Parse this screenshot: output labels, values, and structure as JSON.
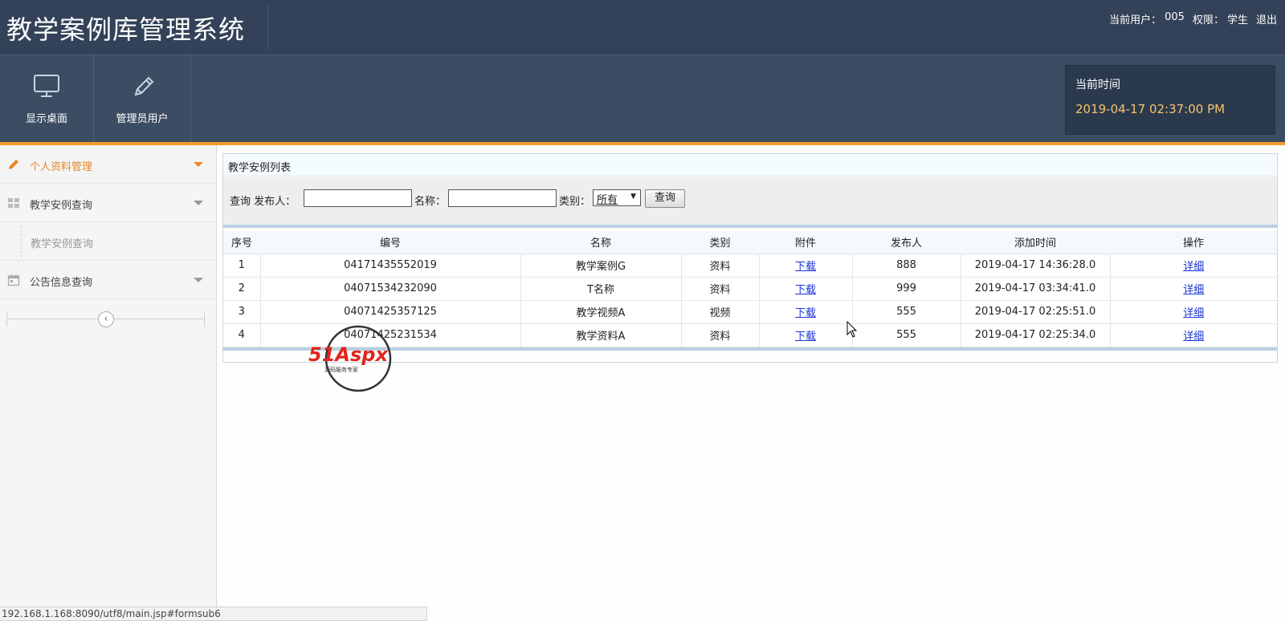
{
  "header": {
    "title": "教学案例库管理系统",
    "current_user_label": "当前用户：",
    "current_user": "005",
    "role_label": "权限：",
    "role": "学生",
    "logout": "退出"
  },
  "toolbar": {
    "desktop_label": "显示桌面",
    "admin_label": "管理员用户",
    "time_label": "当前时间",
    "time_value": "2019-04-17 02:37:00 PM"
  },
  "sidebar": {
    "items": [
      {
        "label": "个人资料管理",
        "icon": "pencil-icon",
        "active": true
      },
      {
        "label": "教学安例查询",
        "icon": "grid-icon"
      },
      {
        "label": "教学安例查询",
        "sub": true
      },
      {
        "label": "公告信息查询",
        "icon": "calendar-icon"
      }
    ],
    "collapse_glyph": "‹"
  },
  "panel": {
    "title": "教学安例列表",
    "search": {
      "query_label": "查询 发布人：",
      "publisher_value": "",
      "name_label": "名称：",
      "name_value": "",
      "type_label": "类别：",
      "type_selected": "所有",
      "button": "查询"
    },
    "columns": [
      "序号",
      "编号",
      "名称",
      "类别",
      "附件",
      "发布人",
      "添加时间",
      "操作"
    ],
    "rows": [
      {
        "seq": "1",
        "code": "04171435552019",
        "name": "教学案例G",
        "type": "资料",
        "attachment": "下载",
        "publisher": "888",
        "time": "2019-04-17 14:36:28.0",
        "action": "详细"
      },
      {
        "seq": "2",
        "code": "04071534232090",
        "name": "T名称",
        "type": "资料",
        "attachment": "下载",
        "publisher": "999",
        "time": "2019-04-17 03:34:41.0",
        "action": "详细"
      },
      {
        "seq": "3",
        "code": "04071425357125",
        "name": "教学视频A",
        "type": "视频",
        "attachment": "下载",
        "publisher": "555",
        "time": "2019-04-17 02:25:51.0",
        "action": "详细"
      },
      {
        "seq": "4",
        "code": "04071425231534",
        "name": "教学资料A",
        "type": "资料",
        "attachment": "下载",
        "publisher": "555",
        "time": "2019-04-17 02:25:34.0",
        "action": "详细"
      }
    ]
  },
  "watermark": {
    "brand": "51Aspx",
    "tagline": "源码服务专家"
  },
  "status_bar": "192.168.1.168:8090/utf8/main.jsp#formsub6",
  "colors": {
    "header_bg": "#334258",
    "toolbar_bg": "#3c4c63",
    "accent": "#f39a2b",
    "time_text": "#f5c56f",
    "link": "#1a34d6"
  }
}
